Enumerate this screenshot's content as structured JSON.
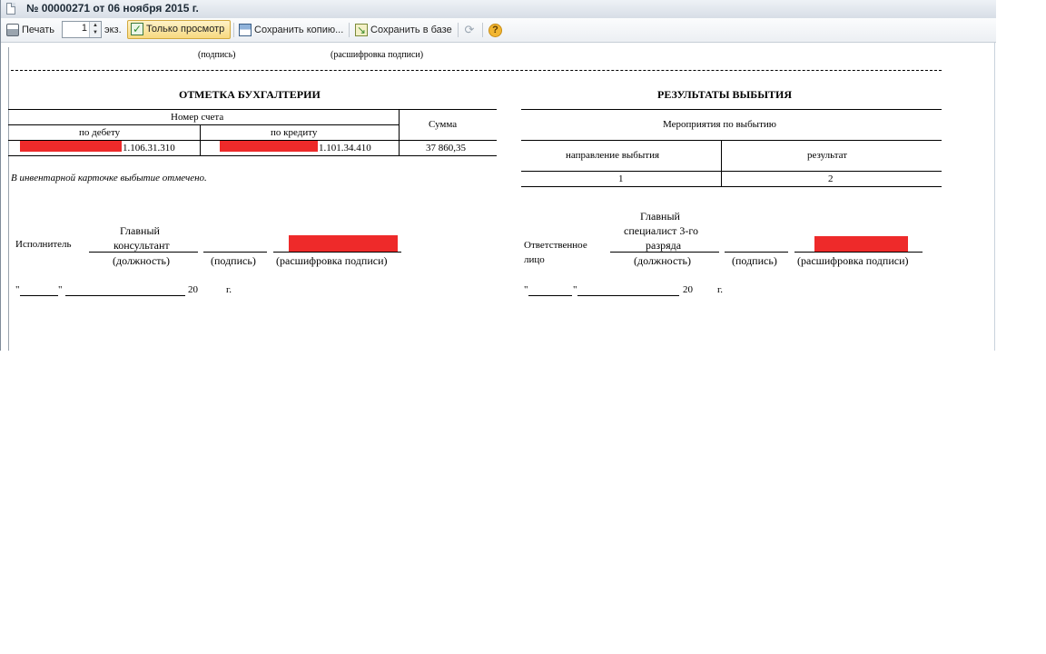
{
  "window": {
    "title": "№ 00000271 от 06 ноября 2015 г."
  },
  "toolbar": {
    "print_label": "Печать",
    "copies_value": "1",
    "copies_suffix": "экз.",
    "view_only_label": "Только просмотр",
    "save_copy_label": "Сохранить копию...",
    "save_db_label": "Сохранить в базе",
    "help_symbol": "?"
  },
  "document": {
    "top_signature_label": "(подпись)",
    "top_decoding_label": "(расшифровка подписи)",
    "accounting": {
      "heading": "ОТМЕТКА БУХГАЛТЕРИИ",
      "account_number_header": "Номер счета",
      "debit_header": "по дебету",
      "credit_header": "по кредиту",
      "sum_header": "Сумма",
      "debit_value": "1.106.31.310",
      "credit_value": "1.101.34.410",
      "sum_value": "37 860,35",
      "note": "В инвентарной карточке выбытие отмечено."
    },
    "results": {
      "heading": "РЕЗУЛЬТАТЫ ВЫБЫТИЯ",
      "measures_header": "Мероприятия по выбытию",
      "direction_header": "направление выбытия",
      "result_header": "результат",
      "col1": "1",
      "col2": "2"
    },
    "executor": {
      "label": "Исполнитель",
      "position_line1": "Главный",
      "position_line2": "консультант",
      "position_caption": "(должность)",
      "signature_caption": "(подпись)",
      "decoding_caption": "(расшифровка подписи)",
      "date_open_quote": "\"",
      "date_close_quote": "\"",
      "year_prefix": "20",
      "year_suffix": "г."
    },
    "responsible": {
      "label_line1": "Ответственное",
      "label_line2": "лицо",
      "position_line1": "Главный",
      "position_line2": "специалист 3-го",
      "position_line3": "разряда",
      "position_caption": "(должность)",
      "signature_caption": "(подпись)",
      "decoding_caption": "(расшифровка подписи)",
      "date_open_quote": "\"",
      "date_close_quote": "\"",
      "year_prefix": "20",
      "year_suffix": "г."
    },
    "redaction_color": "#ee2a2a"
  }
}
